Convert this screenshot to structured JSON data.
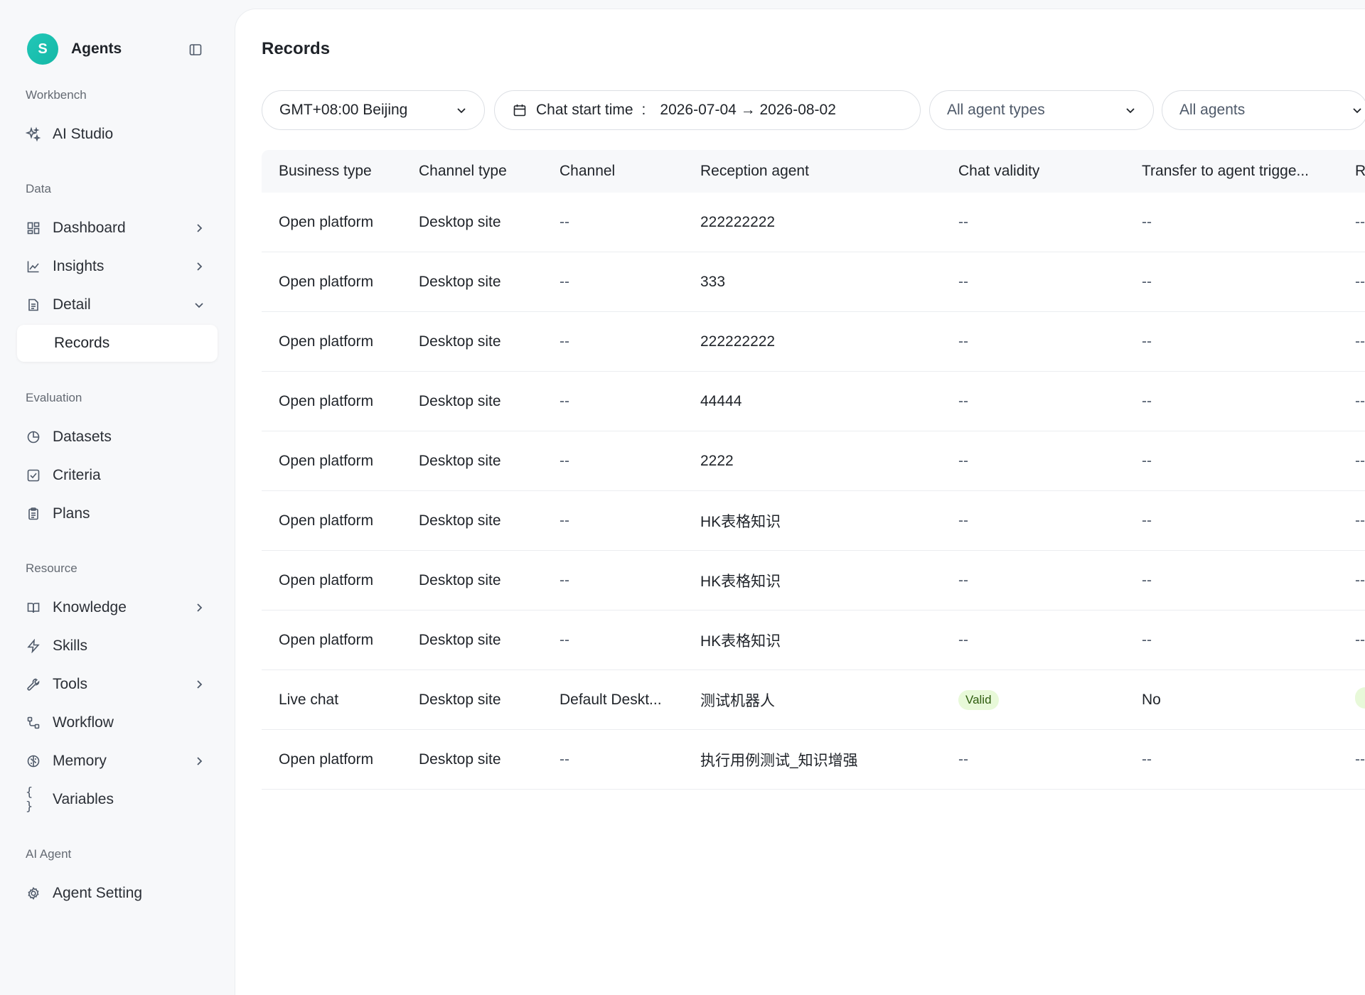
{
  "app": {
    "avatar_letter": "S",
    "name": "Agents"
  },
  "sidebar": {
    "sections": [
      {
        "label": "Workbench"
      },
      {
        "label": "Data"
      },
      {
        "label": "Evaluation"
      },
      {
        "label": "Resource"
      },
      {
        "label": "AI Agent"
      }
    ],
    "items": [
      {
        "label": "AI Studio",
        "icon": "sparkles-icon"
      },
      {
        "label": "Dashboard",
        "icon": "dashboard-icon",
        "chevron": "right"
      },
      {
        "label": "Insights",
        "icon": "line-chart-icon",
        "chevron": "right"
      },
      {
        "label": "Detail",
        "icon": "document-icon",
        "chevron": "down"
      },
      {
        "label": "Records",
        "active": true
      },
      {
        "label": "Datasets",
        "icon": "pie-chart-icon"
      },
      {
        "label": "Criteria",
        "icon": "checkbox-icon"
      },
      {
        "label": "Plans",
        "icon": "clipboard-icon"
      },
      {
        "label": "Knowledge",
        "icon": "book-icon",
        "chevron": "right"
      },
      {
        "label": "Skills",
        "icon": "lightning-icon"
      },
      {
        "label": "Tools",
        "icon": "wrench-icon",
        "chevron": "right"
      },
      {
        "label": "Workflow",
        "icon": "workflow-icon"
      },
      {
        "label": "Memory",
        "icon": "brain-icon",
        "chevron": "right"
      },
      {
        "label": "Variables",
        "icon": "braces-icon"
      },
      {
        "label": "Agent Setting",
        "icon": "gear-icon"
      }
    ]
  },
  "main": {
    "title": "Records",
    "filters": {
      "timezone": "GMT+08:00 Beijing",
      "chat_start_label": "Chat start time",
      "chat_start_sep": ":",
      "date_range": "2026-07-04 → 2026-08-02",
      "agent_types": "All agent types",
      "agents": "All agents"
    },
    "table": {
      "columns": [
        "Business type",
        "Channel type",
        "Channel",
        "Reception agent",
        "Chat validity",
        "Transfer to agent trigge...",
        "R"
      ],
      "rows": [
        [
          "Open platform",
          "Desktop site",
          "--",
          "222222222",
          "--",
          "--",
          "--"
        ],
        [
          "Open platform",
          "Desktop site",
          "--",
          "333",
          "--",
          "--",
          "--"
        ],
        [
          "Open platform",
          "Desktop site",
          "--",
          "222222222",
          "--",
          "--",
          "--"
        ],
        [
          "Open platform",
          "Desktop site",
          "--",
          "44444",
          "--",
          "--",
          "--"
        ],
        [
          "Open platform",
          "Desktop site",
          "--",
          "2222",
          "--",
          "--",
          "--"
        ],
        [
          "Open platform",
          "Desktop site",
          "--",
          "HK表格知识",
          "--",
          "--",
          "--"
        ],
        [
          "Open platform",
          "Desktop site",
          "--",
          "HK表格知识",
          "--",
          "--",
          "--"
        ],
        [
          "Open platform",
          "Desktop site",
          "--",
          "HK表格知识",
          "--",
          "--",
          "--"
        ],
        [
          "Live chat",
          "Desktop site",
          "Default Deskt...",
          "测试机器人",
          "Valid",
          "No",
          ""
        ],
        [
          "Open platform",
          "Desktop site",
          "--",
          "执行用例测试_知识增强",
          "--",
          "--",
          "--"
        ]
      ]
    }
  }
}
